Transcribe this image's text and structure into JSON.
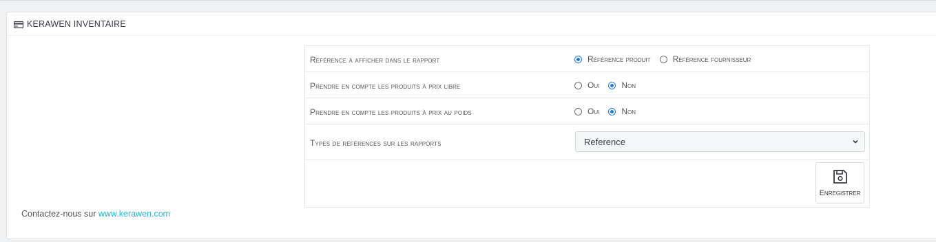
{
  "panel": {
    "title": "KERAWEN INVENTAIRE",
    "icon": "credit-card-icon"
  },
  "rows": [
    {
      "label": "Référence à afficher dans le rapport",
      "options": [
        {
          "label": "Référence produit",
          "checked": true
        },
        {
          "label": "Référence fournisseur",
          "checked": false
        }
      ]
    },
    {
      "label": "Prendre en compte les produits à prix libre",
      "options": [
        {
          "label": "Oui",
          "checked": false
        },
        {
          "label": "Non",
          "checked": true
        }
      ]
    },
    {
      "label": "Prendre en compte les produits à prix au poids",
      "options": [
        {
          "label": "Oui",
          "checked": false
        },
        {
          "label": "Non",
          "checked": true
        }
      ]
    },
    {
      "label": "Types de références sur les rapports",
      "select_value": "Reference"
    }
  ],
  "save_button": {
    "label": "Enregistrer",
    "icon": "floppy-disk-icon"
  },
  "footer": {
    "text": "Contactez-nous sur ",
    "link": "www.kerawen.com"
  },
  "colors": {
    "accent": "#1f7ae0",
    "link": "#25b9d7",
    "background": "#eff1f2"
  }
}
